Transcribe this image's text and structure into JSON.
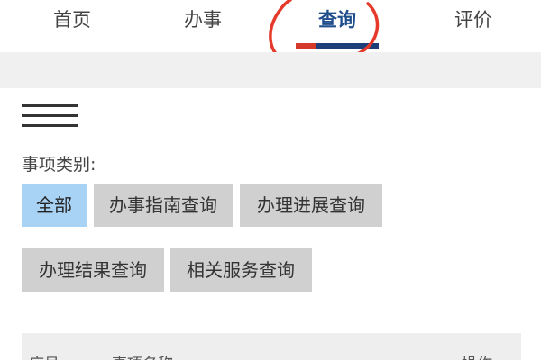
{
  "nav": {
    "tabs": [
      "首页",
      "办事",
      "查询",
      "评价"
    ],
    "active_tab": "查询",
    "indicator_colors": [
      "#d43a2a",
      "#1c3f7a"
    ]
  },
  "filter": {
    "label": "事项类别:",
    "options": [
      "全部",
      "办事指南查询",
      "办理进展查询",
      "办理结果查询",
      "相关服务查询"
    ],
    "selected": "全部"
  },
  "table": {
    "headers": [
      "序号",
      "事项名称",
      "操作"
    ]
  },
  "colors": {
    "selected_chip": "#a9d3f5",
    "chip": "#d0d0d0",
    "annotation": "#e53a2b"
  }
}
